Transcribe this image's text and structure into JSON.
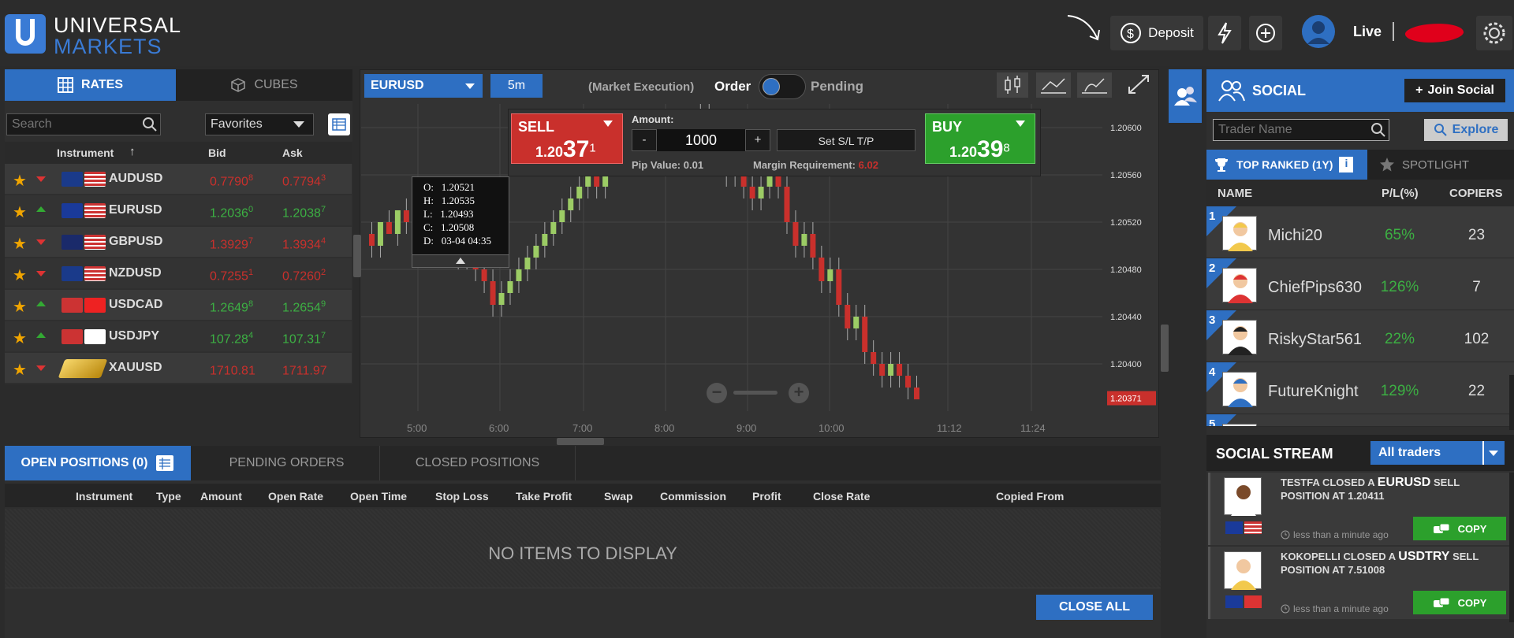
{
  "header": {
    "logo_line1": "UNIVERSAL",
    "logo_line2": "MARKETS",
    "deposit_label": "Deposit",
    "account_mode": "Live"
  },
  "rates_panel": {
    "tab_rates": "RATES",
    "tab_cubes": "CUBES",
    "search_placeholder": "Search",
    "filter_value": "Favorites",
    "col_instrument": "Instrument",
    "col_bid": "Bid",
    "col_ask": "Ask",
    "rows": [
      {
        "name": "AUDUSD",
        "bid_main": "0.7790",
        "bid_sup": "8",
        "ask_main": "0.7794",
        "ask_sup": "3",
        "dir": "down"
      },
      {
        "name": "EURUSD",
        "bid_main": "1.2036",
        "bid_sup": "0",
        "ask_main": "1.2038",
        "ask_sup": "7",
        "dir": "up"
      },
      {
        "name": "GBPUSD",
        "bid_main": "1.3929",
        "bid_sup": "7",
        "ask_main": "1.3934",
        "ask_sup": "4",
        "dir": "down"
      },
      {
        "name": "NZDUSD",
        "bid_main": "0.7255",
        "bid_sup": "1",
        "ask_main": "0.7260",
        "ask_sup": "2",
        "dir": "down"
      },
      {
        "name": "USDCAD",
        "bid_main": "1.2649",
        "bid_sup": "8",
        "ask_main": "1.2654",
        "ask_sup": "9",
        "dir": "up"
      },
      {
        "name": "USDJPY",
        "bid_main": "107.28",
        "bid_sup": "4",
        "ask_main": "107.31",
        "ask_sup": "7",
        "dir": "up"
      },
      {
        "name": "XAUUSD",
        "bid_main": "1710.81",
        "bid_sup": "",
        "ask_main": "1711.97",
        "ask_sup": "",
        "dir": "down"
      }
    ]
  },
  "chart_toolbar": {
    "symbol": "EURUSD",
    "timeframe": "5m",
    "execution": "(Market Execution)",
    "order_label": "Order",
    "pending_label": "Pending"
  },
  "trade_box": {
    "sell_label": "SELL",
    "sell_price_small": "1.20",
    "sell_price_big": "37",
    "sell_price_sup": "1",
    "buy_label": "BUY",
    "buy_price_small": "1.20",
    "buy_price_big": "39",
    "buy_price_sup": "8",
    "amount_label": "Amount:",
    "amount_value": "1000",
    "minus": "-",
    "plus": "+",
    "sltp_label": "Set S/L T/P",
    "pip_value": "Pip Value: 0.01",
    "margin_label": "Margin Requirement:",
    "margin_value": "6.02"
  },
  "ohlc": {
    "o": "O:   1.20521",
    "h": "H:   1.20535",
    "l": "L:   1.20493",
    "c": "C:   1.20508",
    "d": "D:   03-04 04:35"
  },
  "chart_data": {
    "type": "candlestick",
    "y_ticks": [
      "1.20600",
      "1.20560",
      "1.20520",
      "1.20480",
      "1.20440",
      "1.20400"
    ],
    "x_ticks": [
      "5:00",
      "6:00",
      "7:00",
      "8:00",
      "9:00",
      "10:00",
      "11:12",
      "11:24"
    ],
    "current_price": "1.20371",
    "ylim": [
      1.2036,
      1.2062
    ],
    "candles": [
      [
        1.2051,
        1.2052,
        1.2049,
        1.205
      ],
      [
        1.205,
        1.2052,
        1.2049,
        1.2052
      ],
      [
        1.2052,
        1.2053,
        1.2051,
        1.2051
      ],
      [
        1.2051,
        1.2053,
        1.205,
        1.2053
      ],
      [
        1.2053,
        1.2054,
        1.2051,
        1.2052
      ],
      [
        1.2052,
        1.2054,
        1.2051,
        1.2053
      ],
      [
        1.2053,
        1.2055,
        1.2052,
        1.2054
      ],
      [
        1.2054,
        1.2055,
        1.2052,
        1.2053
      ],
      [
        1.2053,
        1.2054,
        1.205,
        1.2051
      ],
      [
        1.2051,
        1.2052,
        1.2049,
        1.205
      ],
      [
        1.205,
        1.2051,
        1.2048,
        1.2049
      ],
      [
        1.2049,
        1.2051,
        1.2048,
        1.205
      ],
      [
        1.205,
        1.2051,
        1.2047,
        1.2048
      ],
      [
        1.2048,
        1.2049,
        1.2046,
        1.2047
      ],
      [
        1.2047,
        1.2048,
        1.2044,
        1.2045
      ],
      [
        1.2045,
        1.2047,
        1.2044,
        1.2046
      ],
      [
        1.2046,
        1.2048,
        1.2045,
        1.2047
      ],
      [
        1.2047,
        1.2049,
        1.2046,
        1.2048
      ],
      [
        1.2048,
        1.205,
        1.2047,
        1.2049
      ],
      [
        1.2049,
        1.2051,
        1.2048,
        1.205
      ],
      [
        1.205,
        1.2052,
        1.2049,
        1.2051
      ],
      [
        1.2051,
        1.2053,
        1.205,
        1.2052
      ],
      [
        1.2052,
        1.2054,
        1.2051,
        1.2053
      ],
      [
        1.2053,
        1.2055,
        1.2052,
        1.2054
      ],
      [
        1.2054,
        1.2056,
        1.2053,
        1.2055
      ],
      [
        1.2055,
        1.2057,
        1.2054,
        1.2056
      ],
      [
        1.2056,
        1.2058,
        1.2054,
        1.2055
      ],
      [
        1.2055,
        1.2057,
        1.2054,
        1.2057
      ],
      [
        1.2057,
        1.2059,
        1.2056,
        1.2058
      ],
      [
        1.2058,
        1.206,
        1.2057,
        1.2059
      ],
      [
        1.2059,
        1.206,
        1.2057,
        1.2058
      ],
      [
        1.2058,
        1.2059,
        1.2056,
        1.2057
      ],
      [
        1.2057,
        1.2059,
        1.2056,
        1.2058
      ],
      [
        1.2058,
        1.206,
        1.2057,
        1.2059
      ],
      [
        1.2059,
        1.2061,
        1.2058,
        1.206
      ],
      [
        1.206,
        1.2061,
        1.2057,
        1.2058
      ],
      [
        1.2058,
        1.2059,
        1.2056,
        1.2057
      ],
      [
        1.2057,
        1.2059,
        1.2056,
        1.2059
      ],
      [
        1.2059,
        1.2062,
        1.2058,
        1.2061
      ],
      [
        1.2061,
        1.2062,
        1.2058,
        1.2059
      ],
      [
        1.2059,
        1.206,
        1.2057,
        1.2058
      ],
      [
        1.2058,
        1.2059,
        1.2055,
        1.2056
      ],
      [
        1.2056,
        1.2058,
        1.2055,
        1.2057
      ],
      [
        1.2057,
        1.2058,
        1.2054,
        1.2055
      ],
      [
        1.2055,
        1.2056,
        1.2053,
        1.2054
      ],
      [
        1.2054,
        1.2056,
        1.2053,
        1.2055
      ],
      [
        1.2055,
        1.2057,
        1.2054,
        1.2056
      ],
      [
        1.2056,
        1.2057,
        1.2054,
        1.2055
      ],
      [
        1.2055,
        1.2056,
        1.2051,
        1.2052
      ],
      [
        1.2052,
        1.2053,
        1.2049,
        1.205
      ],
      [
        1.205,
        1.2052,
        1.2049,
        1.2051
      ],
      [
        1.2051,
        1.2052,
        1.2048,
        1.2049
      ],
      [
        1.2049,
        1.205,
        1.2046,
        1.2047
      ],
      [
        1.2047,
        1.2049,
        1.2046,
        1.2048
      ],
      [
        1.2048,
        1.2049,
        1.2044,
        1.2045
      ],
      [
        1.2045,
        1.2046,
        1.2042,
        1.2043
      ],
      [
        1.2043,
        1.2045,
        1.2042,
        1.2044
      ],
      [
        1.2044,
        1.2045,
        1.204,
        1.2041
      ],
      [
        1.2041,
        1.2042,
        1.2039,
        1.204
      ],
      [
        1.204,
        1.2041,
        1.2038,
        1.2039
      ],
      [
        1.2039,
        1.2041,
        1.2038,
        1.204
      ],
      [
        1.204,
        1.2041,
        1.2038,
        1.2039
      ],
      [
        1.2039,
        1.204,
        1.2037,
        1.2038
      ],
      [
        1.2038,
        1.2039,
        1.2037,
        1.2037
      ]
    ]
  },
  "positions": {
    "tab_open": "OPEN POSITIONS (0)",
    "tab_pending": "PENDING ORDERS",
    "tab_closed": "CLOSED POSITIONS",
    "columns": [
      "Instrument",
      "Type",
      "Amount",
      "Open Rate",
      "Open Time",
      "Stop Loss",
      "Take Profit",
      "Swap",
      "Commission",
      "Profit",
      "Close Rate",
      "Copied From"
    ],
    "empty_text": "NO ITEMS TO DISPLAY",
    "close_all": "CLOSE ALL"
  },
  "social": {
    "title": "SOCIAL",
    "join_label": "Join Social",
    "search_placeholder": "Trader Name",
    "explore_label": "Explore",
    "tab_top": "TOP RANKED (1Y)",
    "tab_spotlight": "SPOTLIGHT",
    "col_name": "NAME",
    "col_pl": "P/L(%)",
    "col_copiers": "COPIERS",
    "traders": [
      {
        "rank": "1",
        "name": "Michi20",
        "pl": "65%",
        "copiers": "23"
      },
      {
        "rank": "2",
        "name": "ChiefPips630",
        "pl": "126%",
        "copiers": "7"
      },
      {
        "rank": "3",
        "name": "RiskyStar561",
        "pl": "22%",
        "copiers": "102"
      },
      {
        "rank": "4",
        "name": "FutureKnight",
        "pl": "129%",
        "copiers": "22"
      },
      {
        "rank": "5",
        "name": "",
        "pl": "",
        "copiers": ""
      }
    ],
    "stream_title": "SOCIAL STREAM",
    "stream_filter": "All traders",
    "stream": [
      {
        "pre": "TESTFA CLOSED A ",
        "sym": "EURUSD",
        "side": " SELL",
        "line2": "POSITION AT 1.20411",
        "time": "less than a minute ago",
        "copy": "COPY"
      },
      {
        "pre": "KOKOPELLI CLOSED A ",
        "sym": "USDTRY",
        "side": " SELL",
        "line2": "POSITION AT 7.51008",
        "time": "less than a minute ago",
        "copy": "COPY"
      }
    ]
  }
}
